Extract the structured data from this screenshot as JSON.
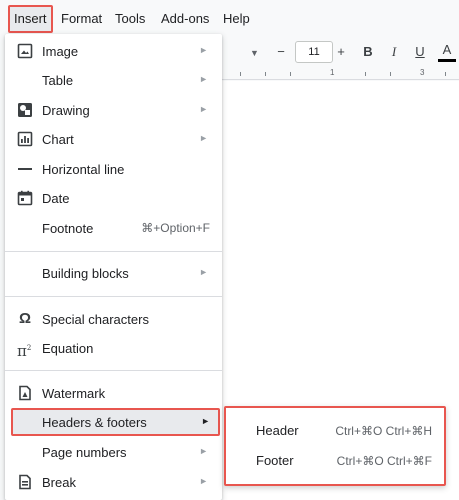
{
  "menubar": {
    "items": [
      {
        "label": "Insert",
        "active": true
      },
      {
        "label": "Format"
      },
      {
        "label": "Tools"
      },
      {
        "label": "Add-ons"
      },
      {
        "label": "Help"
      }
    ]
  },
  "toolbar": {
    "font_size": "11",
    "minus": "−",
    "plus": "+",
    "bold": "B",
    "italic": "I",
    "underline": "U",
    "text_color": "A"
  },
  "ruler": {
    "labels": [
      "1",
      "3"
    ]
  },
  "insert_menu": {
    "items": [
      {
        "label": "Image",
        "icon": "image-icon",
        "submenu": true
      },
      {
        "label": "Table",
        "submenu": true
      },
      {
        "label": "Drawing",
        "icon": "drawing-icon",
        "submenu": true
      },
      {
        "label": "Chart",
        "icon": "chart-icon",
        "submenu": true
      },
      {
        "label": "Horizontal line",
        "icon": "horizontal-line-icon"
      },
      {
        "label": "Date",
        "icon": "calendar-icon"
      },
      {
        "label": "Footnote",
        "shortcut": "⌘+Option+F"
      },
      {
        "label": "Building blocks",
        "submenu": true
      },
      {
        "label": "Special characters",
        "icon": "omega-icon"
      },
      {
        "label": "Equation",
        "icon": "pi-icon"
      },
      {
        "label": "Watermark",
        "icon": "watermark-icon"
      },
      {
        "label": "Headers & footers",
        "submenu": true,
        "highlighted": true
      },
      {
        "label": "Page numbers",
        "submenu": true
      },
      {
        "label": "Break",
        "icon": "break-icon",
        "submenu": true
      }
    ]
  },
  "headers_footers_submenu": {
    "items": [
      {
        "label": "Header",
        "shortcut": "Ctrl+⌘O Ctrl+⌘H"
      },
      {
        "label": "Footer",
        "shortcut": "Ctrl+⌘O Ctrl+⌘F"
      }
    ]
  },
  "colors": {
    "highlight_border": "#e8564f",
    "highlight_bg": "#e8eaed",
    "menu_bg": "#ffffff",
    "app_bg": "#f8f9fa"
  }
}
